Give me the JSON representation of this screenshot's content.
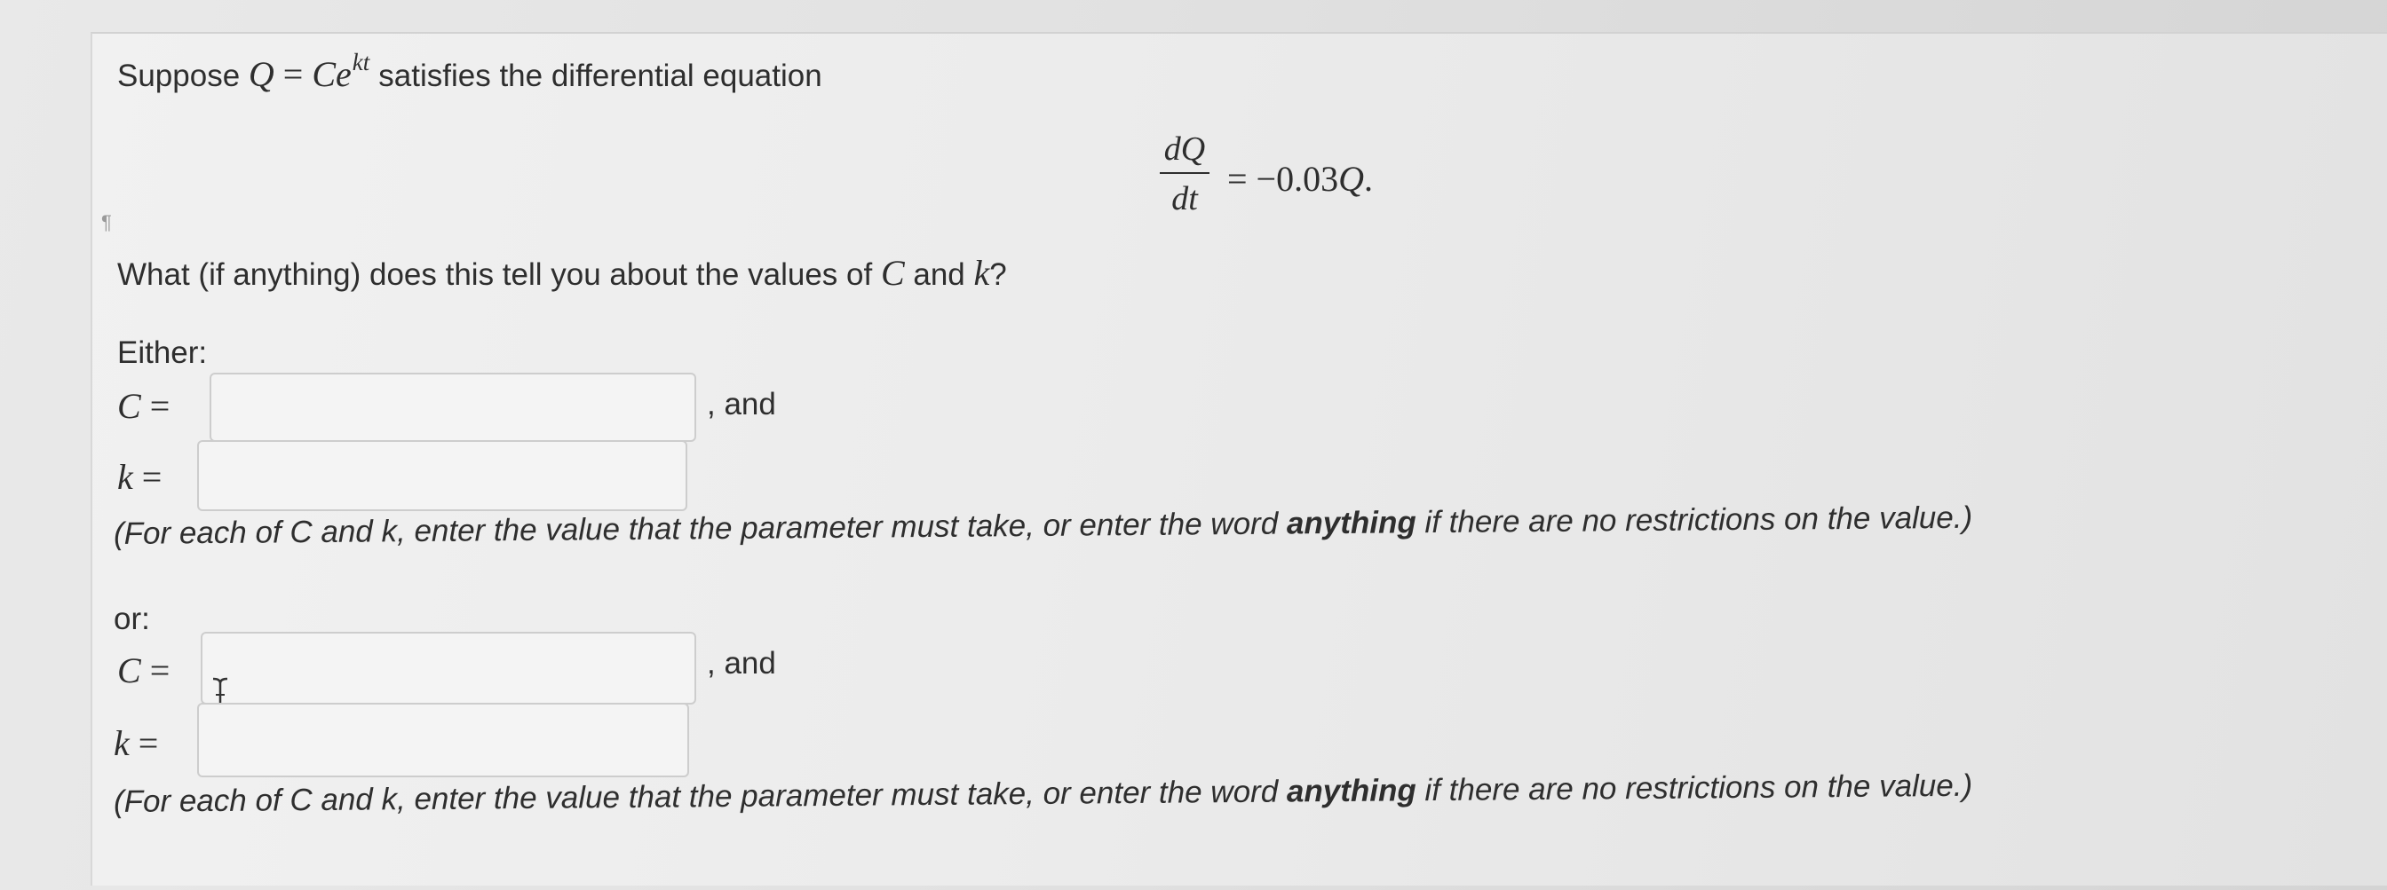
{
  "question": {
    "intro_prefix": "Suppose",
    "equation_Q": "Q",
    "equation_eq": "=",
    "equation_C": "Ce",
    "equation_exp": "kt",
    "intro_suffix": "satisfies the differential equation",
    "frac_num": "dQ",
    "frac_den": "dt",
    "rhs_eq": "= −0.03",
    "rhs_Q": "Q",
    "rhs_dot": ".",
    "prompt_prefix": "What (if anything) does this tell you about the values of",
    "prompt_C": "C",
    "prompt_and": "and",
    "prompt_k": "k",
    "prompt_q": "?"
  },
  "options": [
    {
      "heading": "Either:",
      "c_label": "C",
      "k_label": "k",
      "equals": "=",
      "and_text": ", and",
      "c_value": "",
      "k_value": "",
      "hint_prefix": "(For each of C and k, enter the value that the parameter must take, or enter the word ",
      "hint_bold": "anything",
      "hint_suffix": " if there are no restrictions on the value.)"
    },
    {
      "heading": "or:",
      "c_label": "C",
      "k_label": "k",
      "equals": "=",
      "and_text": ", and",
      "c_value": "",
      "k_value": "",
      "hint_prefix": "(For each of C and k, enter the value that the parameter must take, or enter the word ",
      "hint_bold": "anything",
      "hint_suffix": " if there are no restrictions on the value.)"
    }
  ],
  "icons": {
    "text_cursor": "i-beam-cursor-icon",
    "paragraph_mark": "¶"
  }
}
